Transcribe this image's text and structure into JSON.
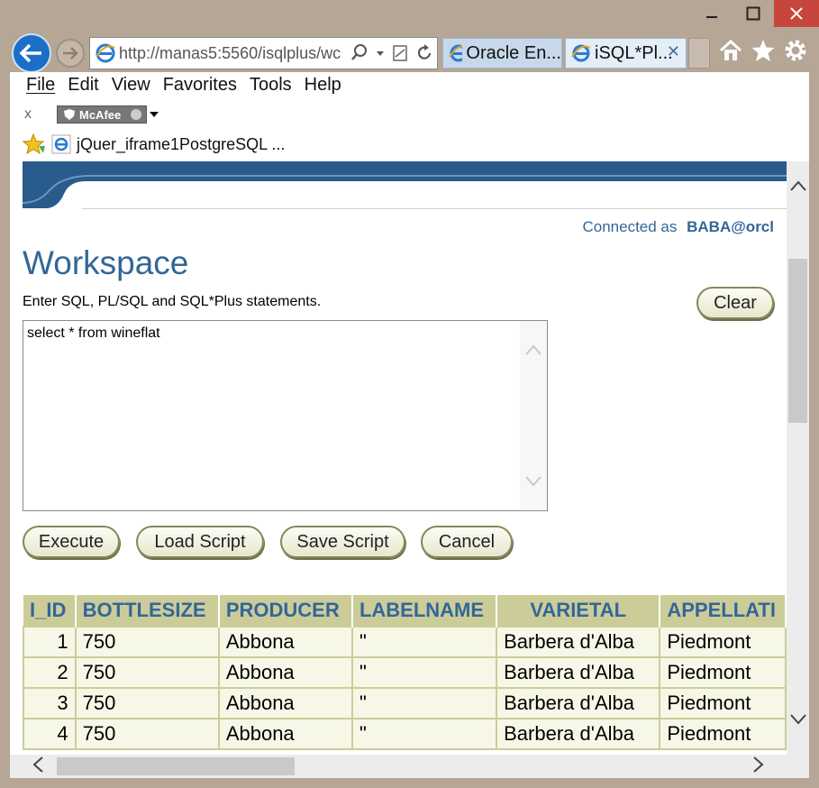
{
  "browser": {
    "address": "http://manas5:5560/isqlplus/wc",
    "tabs": [
      {
        "label": "Oracle En..."
      },
      {
        "label": "iSQL*Pl..."
      }
    ],
    "tab_close": "✕",
    "menu": [
      "File",
      "Edit",
      "View",
      "Favorites",
      "Tools",
      "Help"
    ],
    "addon_close": "x",
    "addon_label": "McAfee",
    "favorite_link": "jQuer_iframe1PostgreSQL ..."
  },
  "page": {
    "connected_label": "Connected as",
    "connected_user": "BABA@orcl",
    "title": "Workspace",
    "hint": "Enter SQL, PL/SQL and SQL*Plus statements.",
    "clear_label": "Clear",
    "sql_text": "select * from wineflat",
    "buttons": {
      "execute": "Execute",
      "load": "Load Script",
      "save": "Save Script",
      "cancel": "Cancel"
    }
  },
  "results": {
    "columns": [
      "I_ID",
      "BOTTLESIZE",
      "PRODUCER",
      "LABELNAME",
      "VARIETAL",
      "APPELLATI"
    ],
    "rows": [
      [
        "1",
        "750",
        "Abbona",
        "\"",
        "Barbera d'Alba",
        "Piedmont"
      ],
      [
        "2",
        "750",
        "Abbona",
        "\"",
        "Barbera d'Alba",
        "Piedmont"
      ],
      [
        "3",
        "750",
        "Abbona",
        "\"",
        "Barbera d'Alba",
        "Piedmont"
      ],
      [
        "4",
        "750",
        "Abbona",
        "\"",
        "Barbera d'Alba",
        "Piedmont"
      ]
    ]
  },
  "colors": {
    "accent": "#336699",
    "table_header": "#cccc99",
    "table_cell": "#f7f7e7"
  }
}
